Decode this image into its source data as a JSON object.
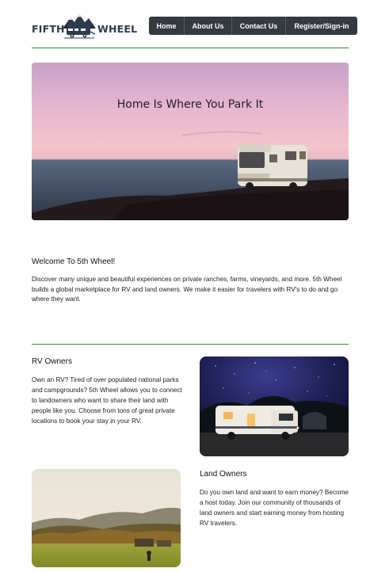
{
  "brand": {
    "left": "FIFTH",
    "right": "WHEEL",
    "icon": "mountain-camper-logo",
    "color": "#2e3a4d"
  },
  "nav": {
    "items": [
      {
        "label": "Home"
      },
      {
        "label": "About Us"
      },
      {
        "label": "Contact Us"
      },
      {
        "label": "Register/Sign-in"
      }
    ],
    "background": "#343a40"
  },
  "hero": {
    "title": "Home Is Where You Park It",
    "image": "rv-on-coast-at-dusk"
  },
  "welcome": {
    "title": "Welcome To 5th Wheel!",
    "text": "Discover many unique and beautiful experiences on private ranches, farms, vineyards, and more. 5th Wheel builds a global marketplace for RV and land owners. We make it easier for travelers with RV's to do and go where they want."
  },
  "rv_owners": {
    "title": "RV Owners",
    "text": "Own an RV? Tired of over populated national parks and campgrounds? 5th Wheel allows you to connect to landowners who want to share their land with people like you. Choose from tons of great private locations to book your stay in your RV.",
    "image": "camper-under-starry-sky"
  },
  "land_owners": {
    "title": "Land Owners",
    "text": "Do you own land and want to earn money? Become a host today. Join our community of thousands of land owners and start earning money from hosting RV travelers.",
    "image": "meadow-with-hills"
  },
  "accent_color": "#2e8b3a"
}
